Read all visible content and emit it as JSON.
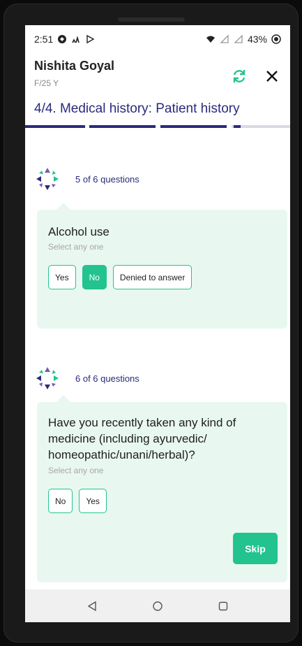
{
  "status_bar": {
    "time": "2:51",
    "battery": "43%"
  },
  "header": {
    "patient_name": "Nishita Goyal",
    "patient_meta": "F/25 Y"
  },
  "section_title": "4/4. Medical history: Patient history",
  "progress": {
    "completed_steps": 3,
    "total_steps": 4,
    "current_step_fraction": 0.12
  },
  "questions": [
    {
      "count_label": "5 of 6 questions",
      "title": "Alcohol use",
      "hint": "Select any one",
      "options": [
        {
          "label": "Yes",
          "selected": false
        },
        {
          "label": "No",
          "selected": true
        },
        {
          "label": "Denied to answer",
          "selected": false
        }
      ]
    },
    {
      "count_label": "6 of 6 questions",
      "title": "Have you recently taken any kind of medicine (including ayurvedic/ homeopathic/unani/herbal)?",
      "hint": "Select any one",
      "options": [
        {
          "label": "No",
          "selected": false
        },
        {
          "label": "Yes",
          "selected": false
        }
      ],
      "skip_label": "Skip"
    }
  ],
  "colors": {
    "brand_navy": "#2b2a7e",
    "accent_green": "#22c38e",
    "card_bg": "#e8f8f1"
  },
  "icons": {
    "refresh": "refresh-icon",
    "close": "close-icon",
    "logo": "app-logo-icon",
    "nav_back": "nav-back-icon",
    "nav_home": "nav-home-icon",
    "nav_recents": "nav-recents-icon"
  }
}
